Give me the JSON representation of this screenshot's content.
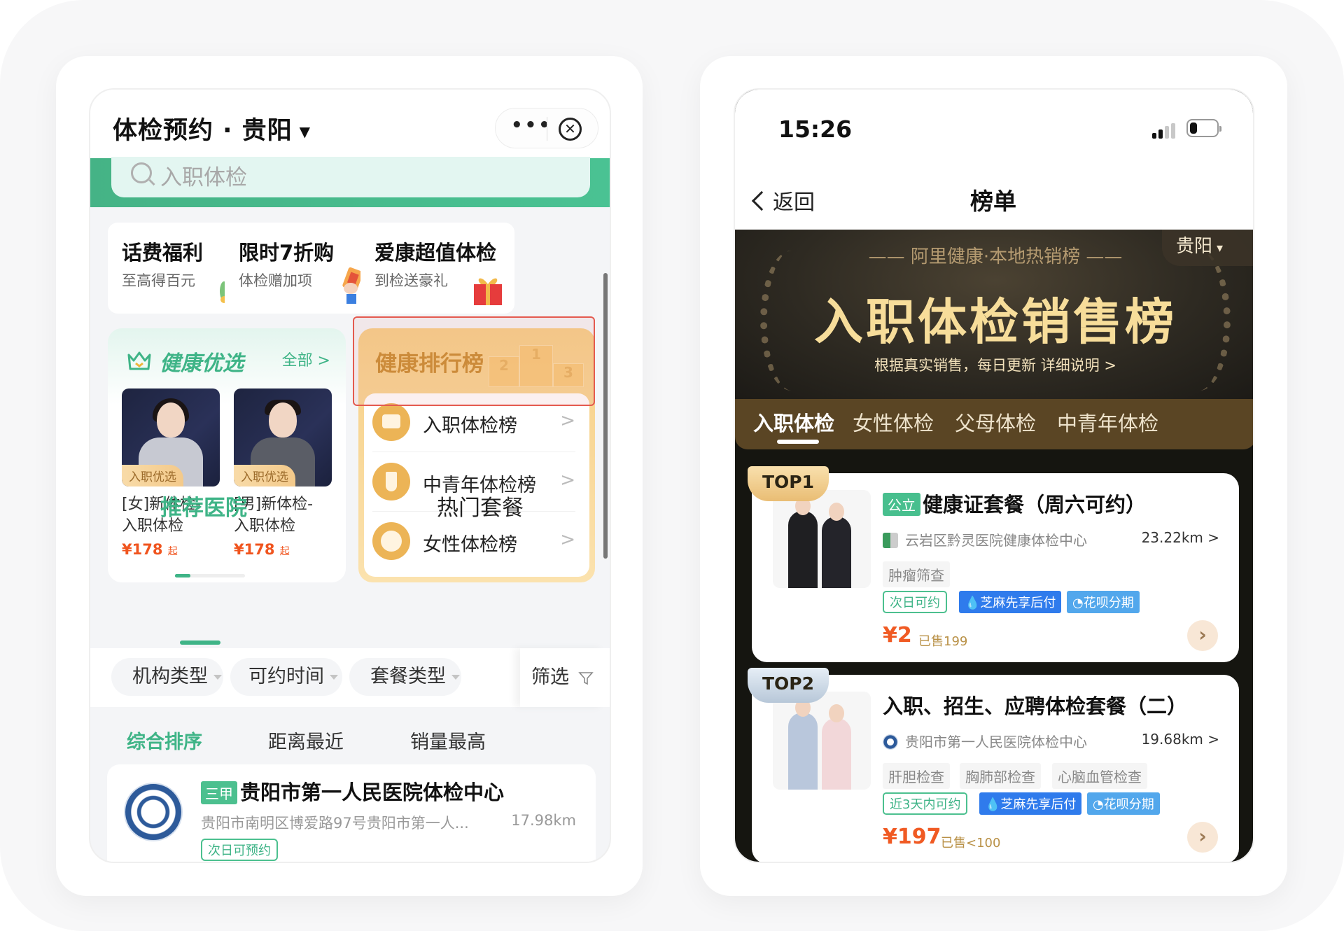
{
  "left_phone": {
    "nav": {
      "title": "体检预约 · 贵阳",
      "city_caret": "▼",
      "more_label": "•••",
      "close_label": "✕"
    },
    "search": {
      "placeholder": "入职体检"
    },
    "promos": [
      {
        "title": "话费福利",
        "subtitle": "至高得百元",
        "art": "phone-bill-icon"
      },
      {
        "title": "限时7折购",
        "subtitle": "体检赠加项",
        "art": "coupon-hand-icon"
      },
      {
        "title": "爱康超值体检",
        "subtitle": "到检送豪礼",
        "art": "gift-icon"
      }
    ],
    "health_selection": {
      "title": "健康优选",
      "all_label": "全部 >",
      "products": [
        {
          "badge": "入职优选",
          "name_line1": "[女]新体检-",
          "name_line2": "入职体检",
          "price": "¥178",
          "price_suffix": "起"
        },
        {
          "badge": "入职优选",
          "name_line1": "[男]新体检-",
          "name_line2": "入职体检",
          "price": "¥178",
          "price_suffix": "起"
        }
      ],
      "pager_fraction": 0.22
    },
    "ranking": {
      "title": "健康排行榜",
      "podium": [
        "2",
        "1",
        "3"
      ],
      "items": [
        {
          "label": "入职体检榜",
          "icon": "briefcase-icon"
        },
        {
          "label": "中青年体检榜",
          "icon": "tie-icon"
        },
        {
          "label": "女性体检榜",
          "icon": "woman-icon"
        }
      ]
    },
    "tabs": [
      {
        "label": "推荐医院",
        "active": true
      },
      {
        "label": "热门套餐",
        "active": false
      }
    ],
    "filters": [
      "机构类型",
      "可约时间",
      "套餐类型"
    ],
    "filter_button": "筛选",
    "sorts": [
      {
        "label": "综合排序",
        "active": true
      },
      {
        "label": "距离最近",
        "active": false
      },
      {
        "label": "销量最高",
        "active": false
      }
    ],
    "hospital": {
      "grade": "三甲",
      "name": "贵阳市第一人民医院体检中心",
      "address": "贵阳市南明区博爱路97号贵阳市第一人...",
      "distance": "17.98km",
      "tag": "次日可预约"
    }
  },
  "right_phone": {
    "status": {
      "time": "15:26"
    },
    "nav": {
      "back_label": "返回",
      "title": "榜单"
    },
    "banner": {
      "subtitle": "—— 阿里健康·本地热销榜 ——",
      "title": "入职体检销售榜",
      "description": "根据真实销售，每日更新  详细说明 >",
      "city": "贵阳"
    },
    "tabs": [
      {
        "label": "入职体检",
        "active": true
      },
      {
        "label": "女性体检",
        "active": false
      },
      {
        "label": "父母体检",
        "active": false
      },
      {
        "label": "中青年体检",
        "active": false
      }
    ],
    "items": [
      {
        "rank": "TOP1",
        "chip": "公立",
        "title": "健康证套餐（周六可约）",
        "org": "云岩区黔灵医院健康体检中心",
        "distance": "23.22km >",
        "features": [
          "肿瘤筛查"
        ],
        "booking": "次日可约",
        "pay1": "💧芝麻先享后付",
        "pay2": "◔花呗分期",
        "price": "¥2",
        "sold": "已售199"
      },
      {
        "rank": "TOP2",
        "chip": "",
        "title": "入职、招生、应聘体检套餐（二）",
        "org": "贵阳市第一人民医院体检中心",
        "distance": "19.68km >",
        "features": [
          "肝胆检查",
          "胸肺部检查",
          "心脑血管检查"
        ],
        "booking": "近3天内可约",
        "pay1": "💧芝麻先享后付",
        "pay2": "◔花呗分期",
        "price": "¥197",
        "sold": "已售<100"
      }
    ]
  },
  "colors": {
    "brand_green": "#3fb487",
    "price_orange": "#f05a23",
    "ranking_gold": "#c98a2c",
    "highlight_red": "#e45a4f",
    "banner_gold": "#f7dd9a"
  }
}
